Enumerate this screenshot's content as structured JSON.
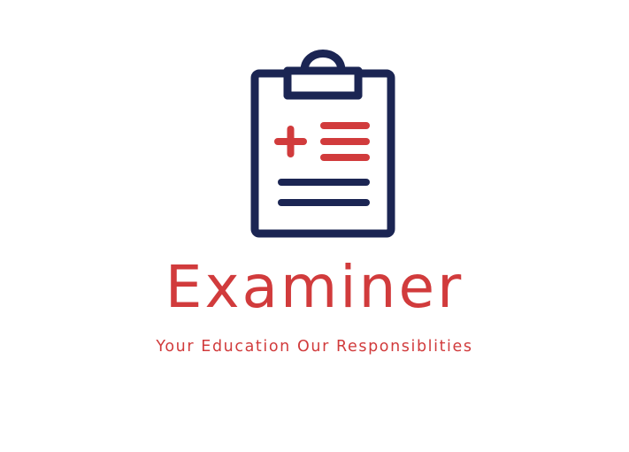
{
  "brand": {
    "name": "Examiner",
    "tagline": "Your Education Our Responsiblities"
  },
  "icon": {
    "name": "clipboard-icon"
  },
  "colors": {
    "navy": "#1b2553",
    "red": "#d13b3c",
    "background": "#ffffff"
  }
}
